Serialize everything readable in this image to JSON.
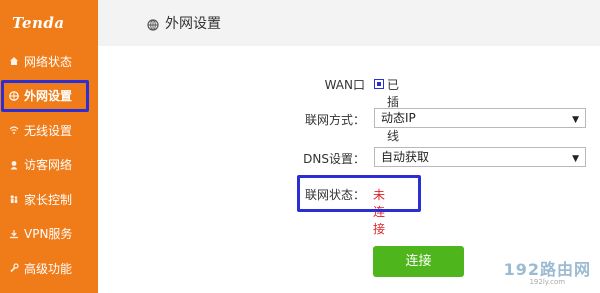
{
  "brand": {
    "logo_text": "Tenda"
  },
  "sidebar": {
    "items": [
      {
        "label": "网络状态",
        "icon": "home-icon"
      },
      {
        "label": "外网设置",
        "icon": "globe-icon",
        "active": true
      },
      {
        "label": "无线设置",
        "icon": "wifi-icon"
      },
      {
        "label": "访客网络",
        "icon": "guest-icon"
      },
      {
        "label": "家长控制",
        "icon": "parental-icon"
      },
      {
        "label": "VPN服务",
        "icon": "download-icon"
      },
      {
        "label": "高级功能",
        "icon": "wrench-icon"
      }
    ]
  },
  "header": {
    "title": "外网设置",
    "icon": "globe-icon"
  },
  "form": {
    "wan": {
      "label": "WAN口",
      "value": "已插网线"
    },
    "mode": {
      "label": "联网方式：",
      "value": "动态IP"
    },
    "dns": {
      "label": "DNS设置：",
      "value": "自动获取"
    },
    "status": {
      "label": "联网状态：",
      "value": "未连接",
      "value_color": "#e0232b"
    }
  },
  "connect_button": {
    "label": "连接"
  },
  "watermark": {
    "main": "192路由网",
    "sub": "192ly.com"
  },
  "colors": {
    "sidebar": "#f07c19",
    "highlight": "#2b2fd3",
    "button": "#4fb51d",
    "header_bg": "#f3f3f3"
  }
}
